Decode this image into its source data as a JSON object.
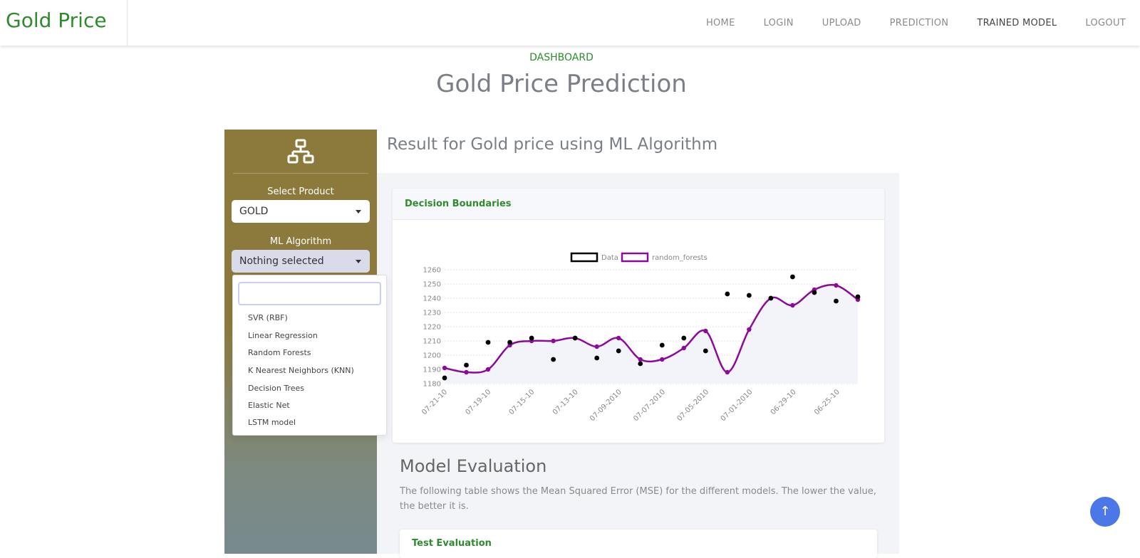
{
  "navbar": {
    "brand": "Gold Price",
    "links": [
      "HOME",
      "LOGIN",
      "UPLOAD",
      "PREDICTION",
      "TRAINED MODEL",
      "LOGOUT"
    ],
    "active": "TRAINED MODEL"
  },
  "header": {
    "eyebrow": "DASHBOARD",
    "title": "Gold Price Prediction"
  },
  "sidebar": {
    "icon": "sitemap-icon",
    "product_label": "Select Product",
    "product_value": "GOLD",
    "algo_label": "ML Algorithm",
    "algo_value": "Nothing selected",
    "search_placeholder": "",
    "options": [
      "SVR (RBF)",
      "Linear Regression",
      "Random Forests",
      "K Nearest Neighbors (KNN)",
      "Decision Trees",
      "Elastic Net",
      "LSTM model"
    ]
  },
  "main": {
    "heading": "Result for Gold price using ML Algorithm",
    "card_title": "Decision Boundaries",
    "eval_title": "Model Evaluation",
    "eval_text": "The following table shows the Mean Squared Error (MSE) for the different models. The lower the value, the better it is.",
    "test_card_title": "Test Evaluation"
  },
  "scroll_top": "↑",
  "chart_data": {
    "type": "line",
    "legend": [
      "Data",
      "random_forests"
    ],
    "legend_position": "top-center",
    "ylim": [
      1180,
      1260
    ],
    "yticks": [
      1180,
      1190,
      1200,
      1210,
      1220,
      1230,
      1240,
      1250,
      1260
    ],
    "xtick_labels": [
      "07-21-10",
      "07-19-10",
      "07-15-10",
      "07-13-10",
      "07-09-2010",
      "07-07-2010",
      "07-05-2010",
      "07-01-2010",
      "06-29-10",
      "06-25-10"
    ],
    "series": [
      {
        "name": "Data",
        "style": "scatter",
        "color": "#000000",
        "values": [
          1184,
          1193,
          1209,
          1209,
          1212,
          1197,
          1212,
          1198,
          1203,
          1194,
          1207,
          1212,
          1203,
          1243,
          1242,
          1240,
          1255,
          1244,
          1238,
          1241
        ]
      },
      {
        "name": "random_forests",
        "style": "line",
        "color": "#8b0a9b",
        "values": [
          1191,
          1188,
          1190,
          1207,
          1210,
          1210,
          1212,
          1206,
          1212,
          1197,
          1197,
          1205,
          1217,
          1188,
          1218,
          1240,
          1235,
          1246,
          1249,
          1239
        ]
      }
    ],
    "grid": true
  }
}
